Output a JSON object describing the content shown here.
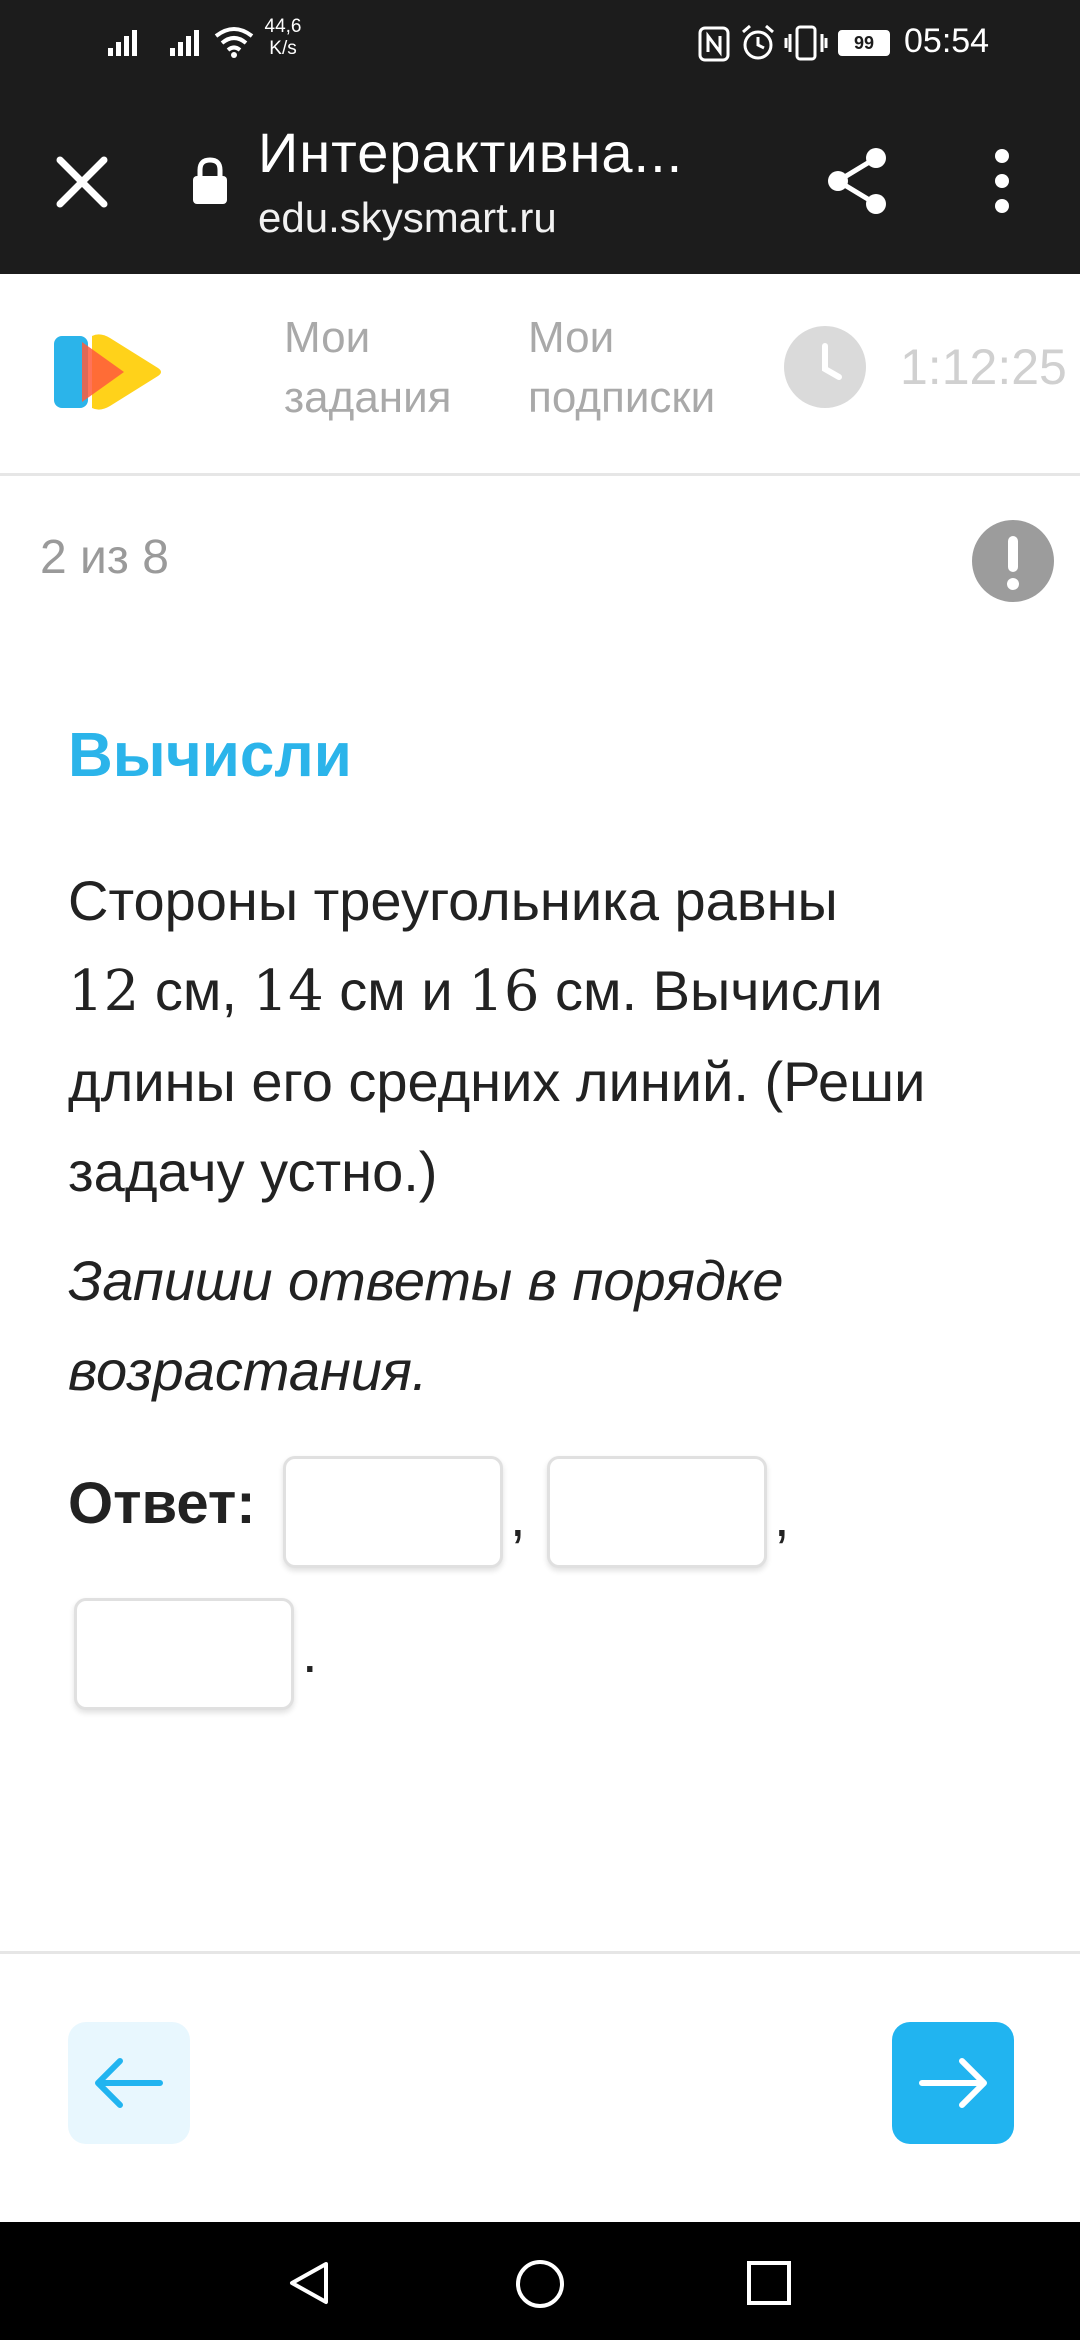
{
  "status_bar": {
    "net_speed_value": "44,6",
    "net_speed_unit": "K/s",
    "battery": "99",
    "time": "05:54",
    "icons": [
      "signal-icon",
      "signal-icon",
      "wifi-icon",
      "nfc-icon",
      "alarm-icon",
      "vibrate-icon",
      "battery-icon"
    ]
  },
  "browser": {
    "title": "Интерактивна...",
    "url": "edu.skysmart.ru",
    "icons": [
      "close-icon",
      "lock-icon",
      "share-icon",
      "more-vert-icon"
    ]
  },
  "header": {
    "nav": [
      {
        "line1": "Мои",
        "line2": "задания"
      },
      {
        "line1": "Мои",
        "line2": "подписки"
      }
    ],
    "timer": "1:12:25",
    "colors": {
      "logo_blue": "#2bb4ea",
      "logo_yellow": "#ffd21a",
      "logo_red": "#ff5a3c"
    }
  },
  "task": {
    "progress": "2 из 8",
    "heading": "Вычисли",
    "text_parts": [
      "Стороны треугольника равны",
      "12",
      " см, ",
      "14",
      " см и ",
      "16",
      " см. Вычисли длины его средних линий. (Реши задачу устно.)"
    ],
    "hint": "Запиши ответы в порядке возрастания.",
    "answer_label": "Ответ:",
    "separators": [
      ",",
      ",",
      "."
    ],
    "answers": [
      "",
      "",
      ""
    ]
  },
  "footer": {
    "prev": "arrow-left-icon",
    "next": "arrow-right-icon",
    "accent": "#21b4f0"
  }
}
